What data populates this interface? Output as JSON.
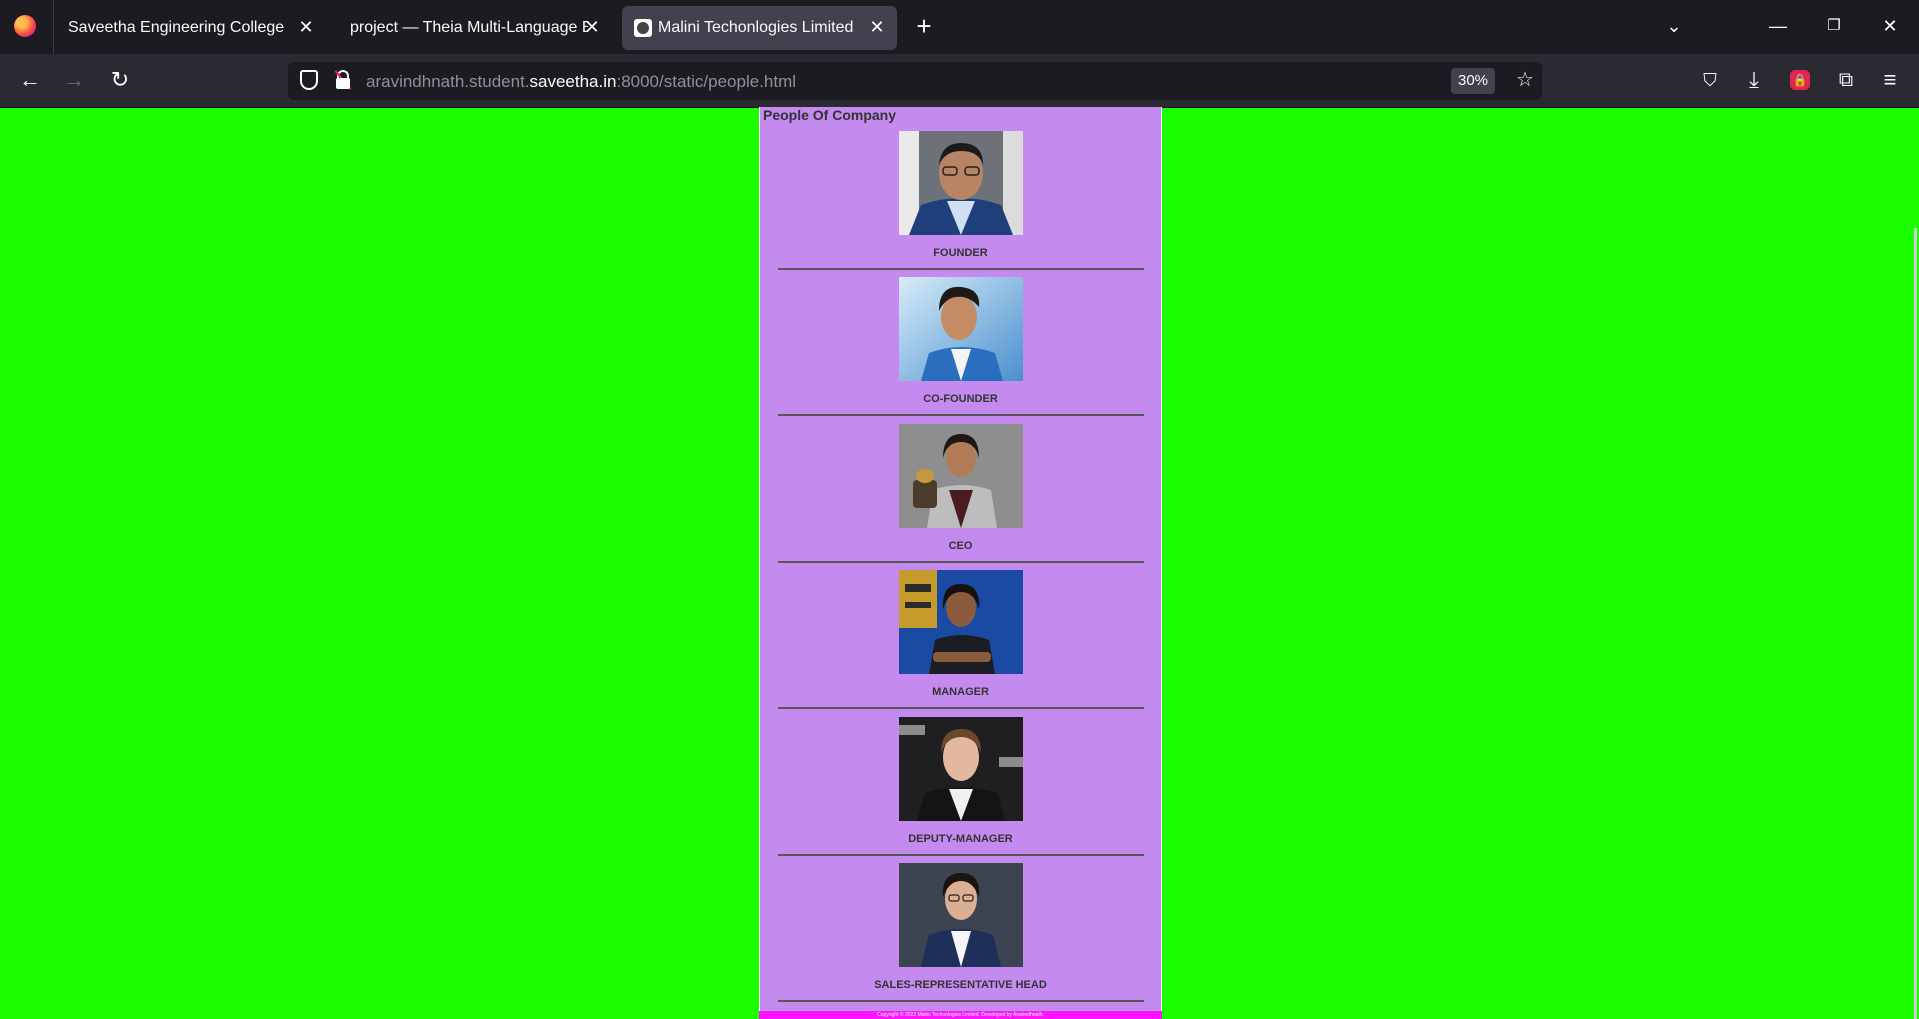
{
  "browser": {
    "tabs": [
      {
        "label": "Saveetha Engineering College",
        "active": false
      },
      {
        "label": "project — Theia Multi-Language Ex",
        "active": false
      },
      {
        "label": "Malini Techonlogies Limited",
        "active": true
      }
    ],
    "url_prefix": "aravindhnath.student.",
    "url_host": "saveetha.in",
    "url_suffix": ":8000/static/people.html",
    "zoom": "30%"
  },
  "page": {
    "title": "People Of Company",
    "people": [
      {
        "role": "FOUNDER"
      },
      {
        "role": "CO-FOUNDER"
      },
      {
        "role": "CEO"
      },
      {
        "role": "MANAGER"
      },
      {
        "role": "DEPUTY-MANAGER"
      },
      {
        "role": "SALES-REPRESENTATIVE HEAD"
      }
    ],
    "footer": "Copyright © 2022 Malini Techonlogies Limited. Developed by Aravindhnath."
  },
  "colors": {
    "page_background": "#1cff00",
    "content_background": "#c58af0",
    "footer_background": "#ff14ff"
  }
}
